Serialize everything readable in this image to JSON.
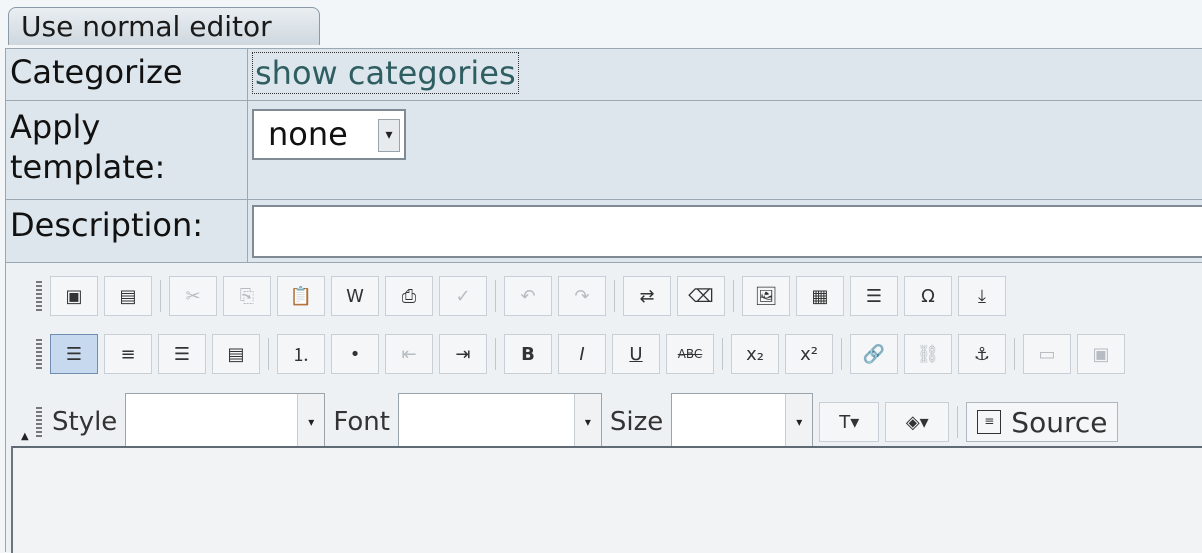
{
  "tab": {
    "label": "Use normal editor"
  },
  "form": {
    "categorize_label": "Categorize",
    "categories_link": "show categories",
    "template_label": "Apply template:",
    "template_value": "none",
    "description_label": "Description:",
    "description_value": ""
  },
  "toolbar": {
    "row1": [
      "preview-icon",
      "template-icon",
      "cut-icon",
      "copy-icon",
      "paste-icon",
      "paste-word-icon",
      "print-icon",
      "spellcheck-icon",
      "undo-icon",
      "redo-icon",
      "find-replace-icon",
      "eraser-icon",
      "image-icon",
      "table-icon",
      "horizontal-rule-icon",
      "special-char-icon",
      "page-break-icon"
    ],
    "row2": [
      "align-left-icon",
      "align-center-icon",
      "align-right-icon",
      "justify-icon",
      "ordered-list-icon",
      "unordered-list-icon",
      "outdent-icon",
      "indent-icon",
      "bold-icon",
      "italic-icon",
      "underline-icon",
      "strikethrough-icon",
      "subscript-icon",
      "superscript-icon",
      "link-icon",
      "unlink-icon",
      "anchor-icon",
      "flash-icon",
      "iframe-icon"
    ],
    "row2_text": {
      "bold": "B",
      "italic": "I",
      "underline": "U",
      "strike": "ABC",
      "sub": "x₂",
      "sup": "x²"
    },
    "style_label": "Style",
    "font_label": "Font",
    "size_label": "Size",
    "source_label": "Source"
  }
}
